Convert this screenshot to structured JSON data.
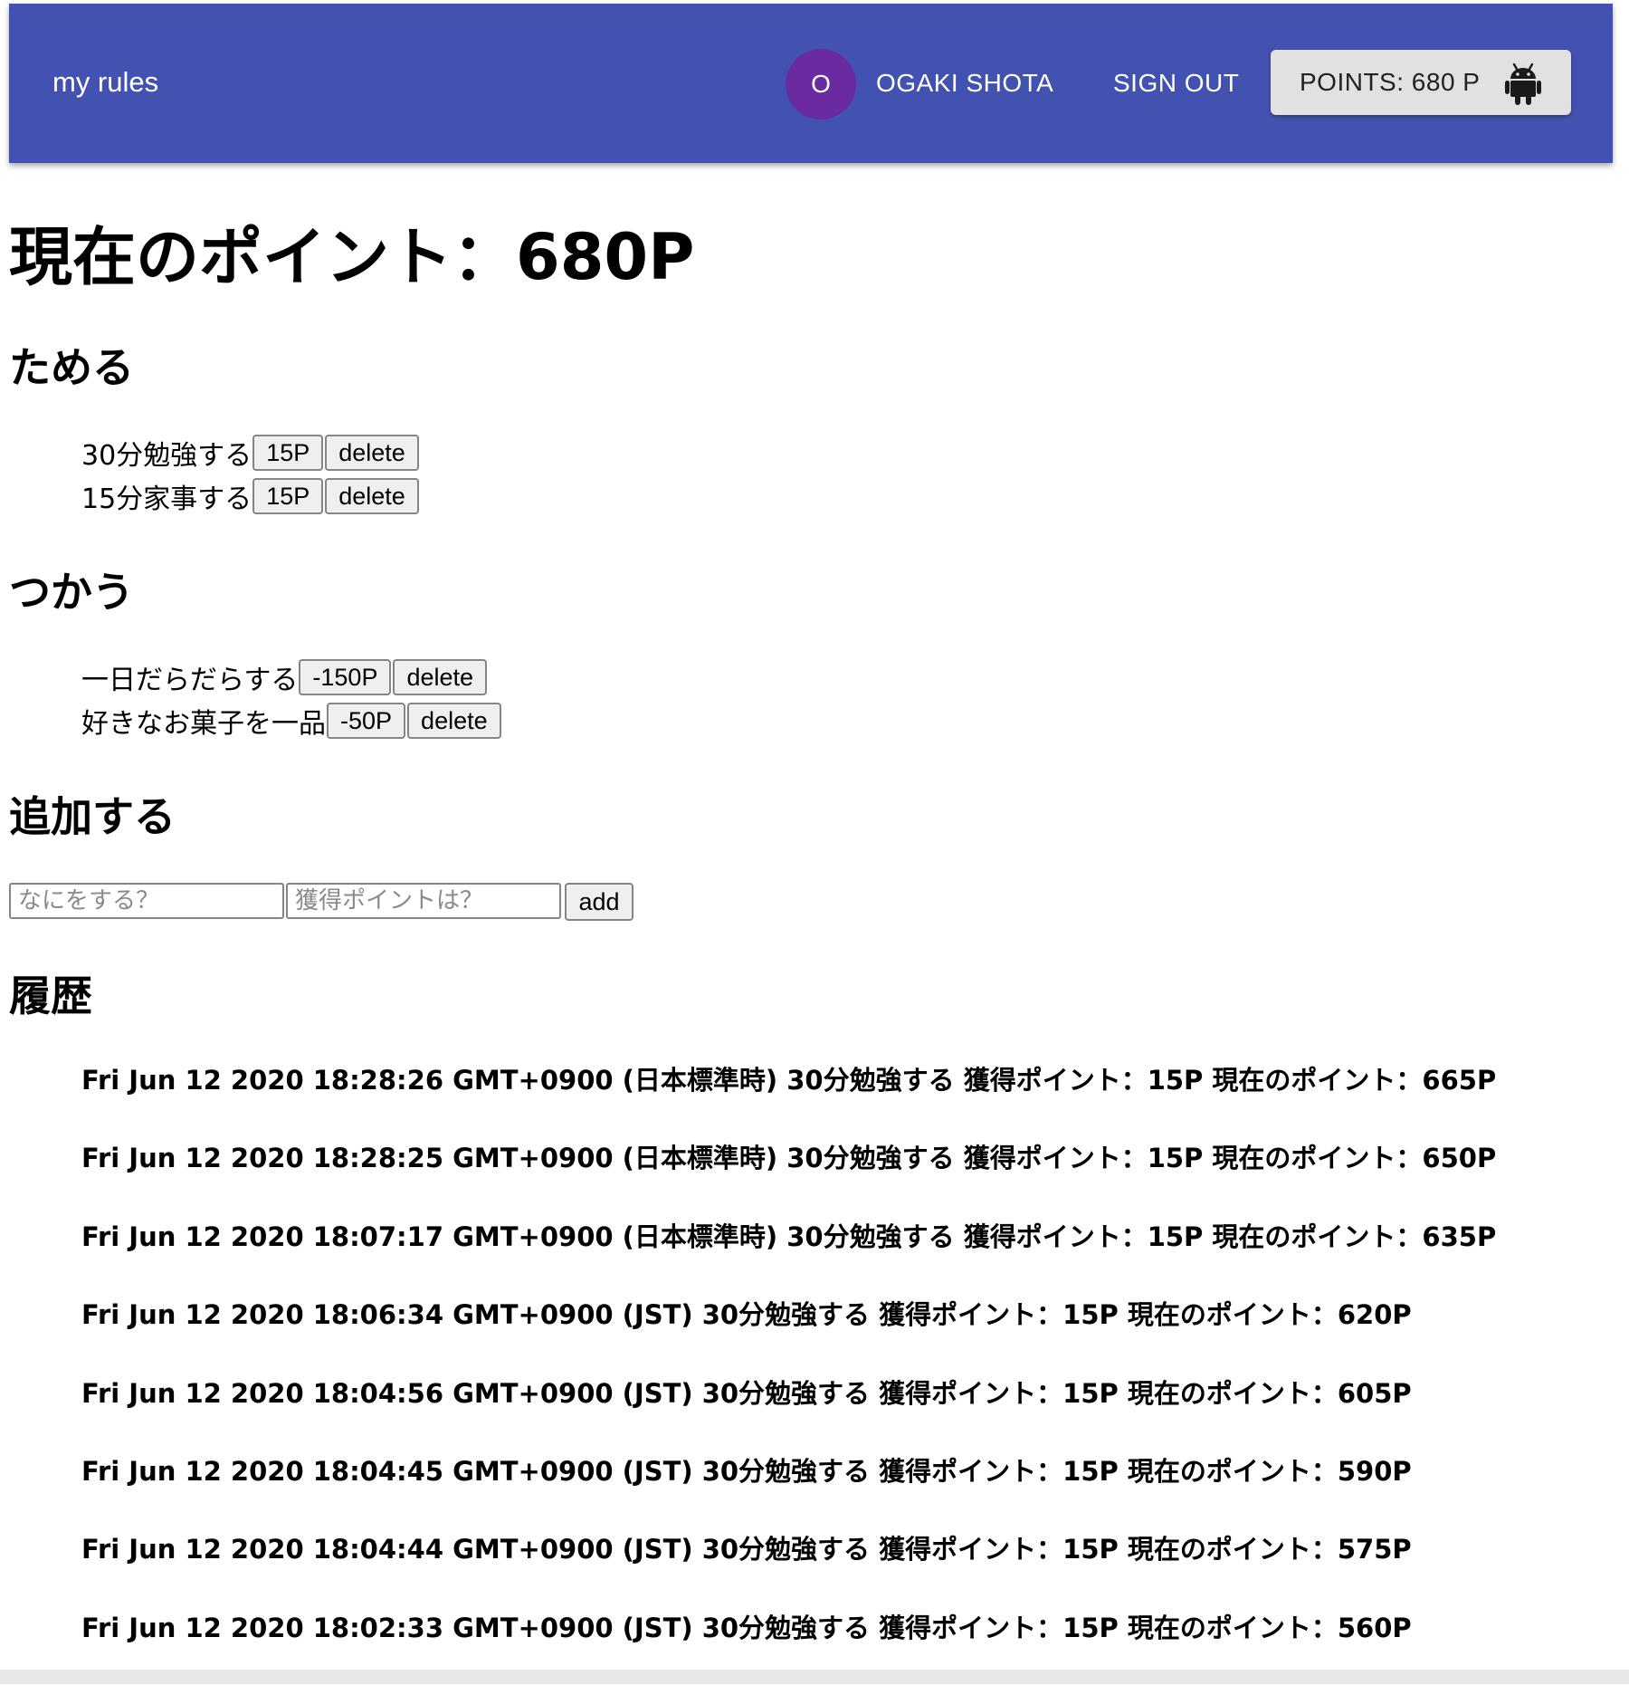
{
  "appbar": {
    "brand": "my rules",
    "avatar_initial": "O",
    "username": "OGAKI SHOTA",
    "sign_out": "SIGN OUT",
    "points_label": "POINTS: 680 P",
    "points_icon": "android-icon",
    "color": "#4352b1",
    "avatar_color": "#6a2aa0"
  },
  "page_title": "現在のポイント：680P",
  "earn": {
    "heading": "ためる",
    "items": [
      {
        "label": "30分勉強する",
        "points": "15P",
        "delete": "delete"
      },
      {
        "label": "15分家事する",
        "points": "15P",
        "delete": "delete"
      }
    ]
  },
  "spend": {
    "heading": "つかう",
    "items": [
      {
        "label": "一日だらだらする",
        "points": "-150P",
        "delete": "delete"
      },
      {
        "label": "好きなお菓子を一品",
        "points": "-50P",
        "delete": "delete"
      }
    ]
  },
  "add": {
    "heading": "追加する",
    "what_value": "",
    "what_placeholder": "なにをする？",
    "points_value": "",
    "points_placeholder": "獲得ポイントは？",
    "button": "add"
  },
  "history": {
    "heading": "履歴",
    "items": [
      "Fri Jun 12 2020 18:28:26 GMT+0900 (日本標準時) 30分勉強する 獲得ポイント：15P 現在のポイント：665P",
      "Fri Jun 12 2020 18:28:25 GMT+0900 (日本標準時) 30分勉強する 獲得ポイント：15P 現在のポイント：650P",
      "Fri Jun 12 2020 18:07:17 GMT+0900 (日本標準時) 30分勉強する 獲得ポイント：15P 現在のポイント：635P",
      "Fri Jun 12 2020 18:06:34 GMT+0900 (JST) 30分勉強する 獲得ポイント：15P 現在のポイント：620P",
      "Fri Jun 12 2020 18:04:56 GMT+0900 (JST) 30分勉強する 獲得ポイント：15P 現在のポイント：605P",
      "Fri Jun 12 2020 18:04:45 GMT+0900 (JST) 30分勉強する 獲得ポイント：15P 現在のポイント：590P",
      "Fri Jun 12 2020 18:04:44 GMT+0900 (JST) 30分勉強する 獲得ポイント：15P 現在のポイント：575P",
      "Fri Jun 12 2020 18:02:33 GMT+0900 (JST) 30分勉強する 獲得ポイント：15P 現在のポイント：560P"
    ]
  }
}
